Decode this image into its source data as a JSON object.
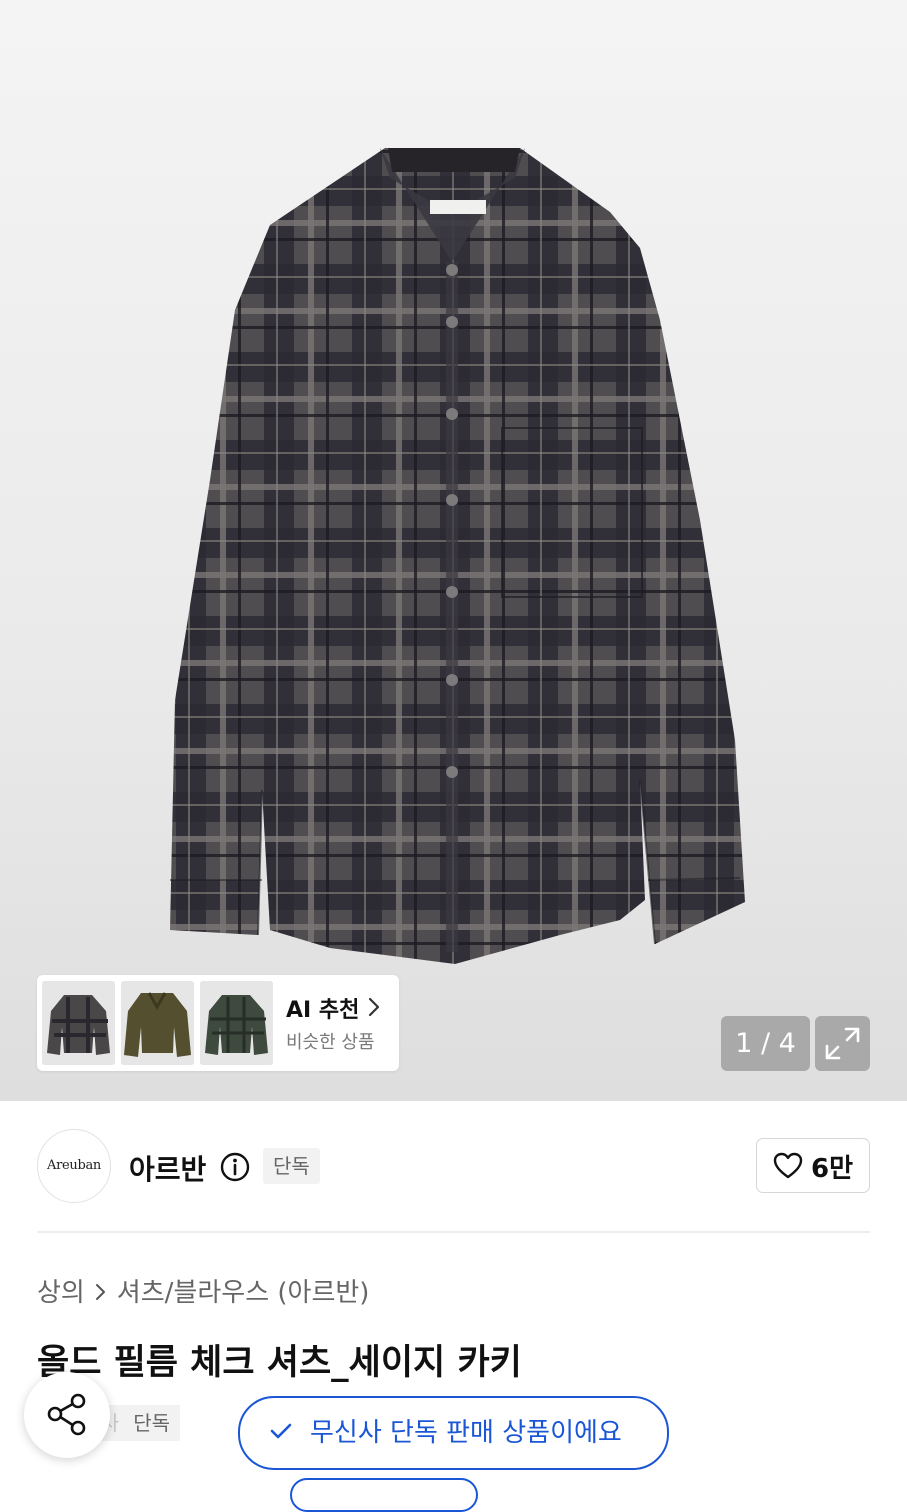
{
  "gallery": {
    "reco_title": "AI 추천",
    "reco_subtitle": "비슷한 상품",
    "counter": "1 / 4"
  },
  "brand": {
    "logo_text": "Areuban",
    "name": "아르반",
    "badge": "단독",
    "likes": "6만"
  },
  "breadcrumb": {
    "category": "상의",
    "subcategory": "셔츠/블라우스 (아르반)"
  },
  "product": {
    "title": "올드 필름 체크 셔츠_세이지 카키"
  },
  "tags": {
    "partial_label": "무신사",
    "exclusive": "단독"
  },
  "toast": {
    "message": "무신사 단독 판매 상품이에요"
  },
  "colors": {
    "accent": "#1a56d6",
    "counter_bg": "#a9a9a9"
  },
  "icons": {
    "reco_chevron": "chevron-right-icon",
    "expand": "expand-icon",
    "info": "info-icon",
    "like": "heart-icon",
    "share": "share-icon",
    "toast_check": "check-icon"
  }
}
